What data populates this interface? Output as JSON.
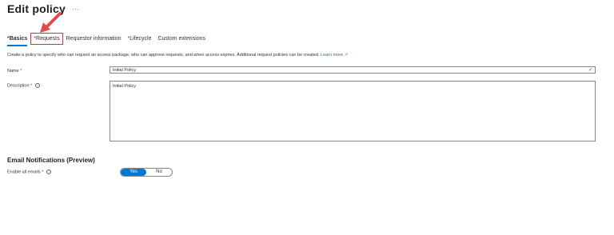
{
  "header": {
    "title": "Edit policy",
    "more_label": "···"
  },
  "tabs": [
    {
      "label": "Basics",
      "required": true,
      "active": true,
      "highlighted": false
    },
    {
      "label": "Requests",
      "required": true,
      "active": false,
      "highlighted": true
    },
    {
      "label": "Requestor information",
      "required": false,
      "active": false,
      "highlighted": false
    },
    {
      "label": "Lifecycle",
      "required": true,
      "active": false,
      "highlighted": false
    },
    {
      "label": "Custom extensions",
      "required": false,
      "active": false,
      "highlighted": false
    }
  ],
  "intro": {
    "text": "Create a policy to specify who can request an access package, who can approve requests, and when access expires. Additional request policies can be created.",
    "link": "Learn more"
  },
  "form": {
    "name": {
      "label": "Name",
      "required_mark": "*",
      "value": "Initial Policy",
      "valid": true
    },
    "description": {
      "label": "Description",
      "required_mark": "*",
      "value": "Initial Policy"
    }
  },
  "email": {
    "section_title": "Email Notifications (Preview)",
    "label": "Enable all emails",
    "required_mark": "*",
    "options": [
      "Yes",
      "No"
    ],
    "selected": "Yes"
  },
  "colors": {
    "accent": "#0078d4",
    "required": "#a4262c",
    "highlight": "#d13438",
    "valid": "#107c10"
  }
}
